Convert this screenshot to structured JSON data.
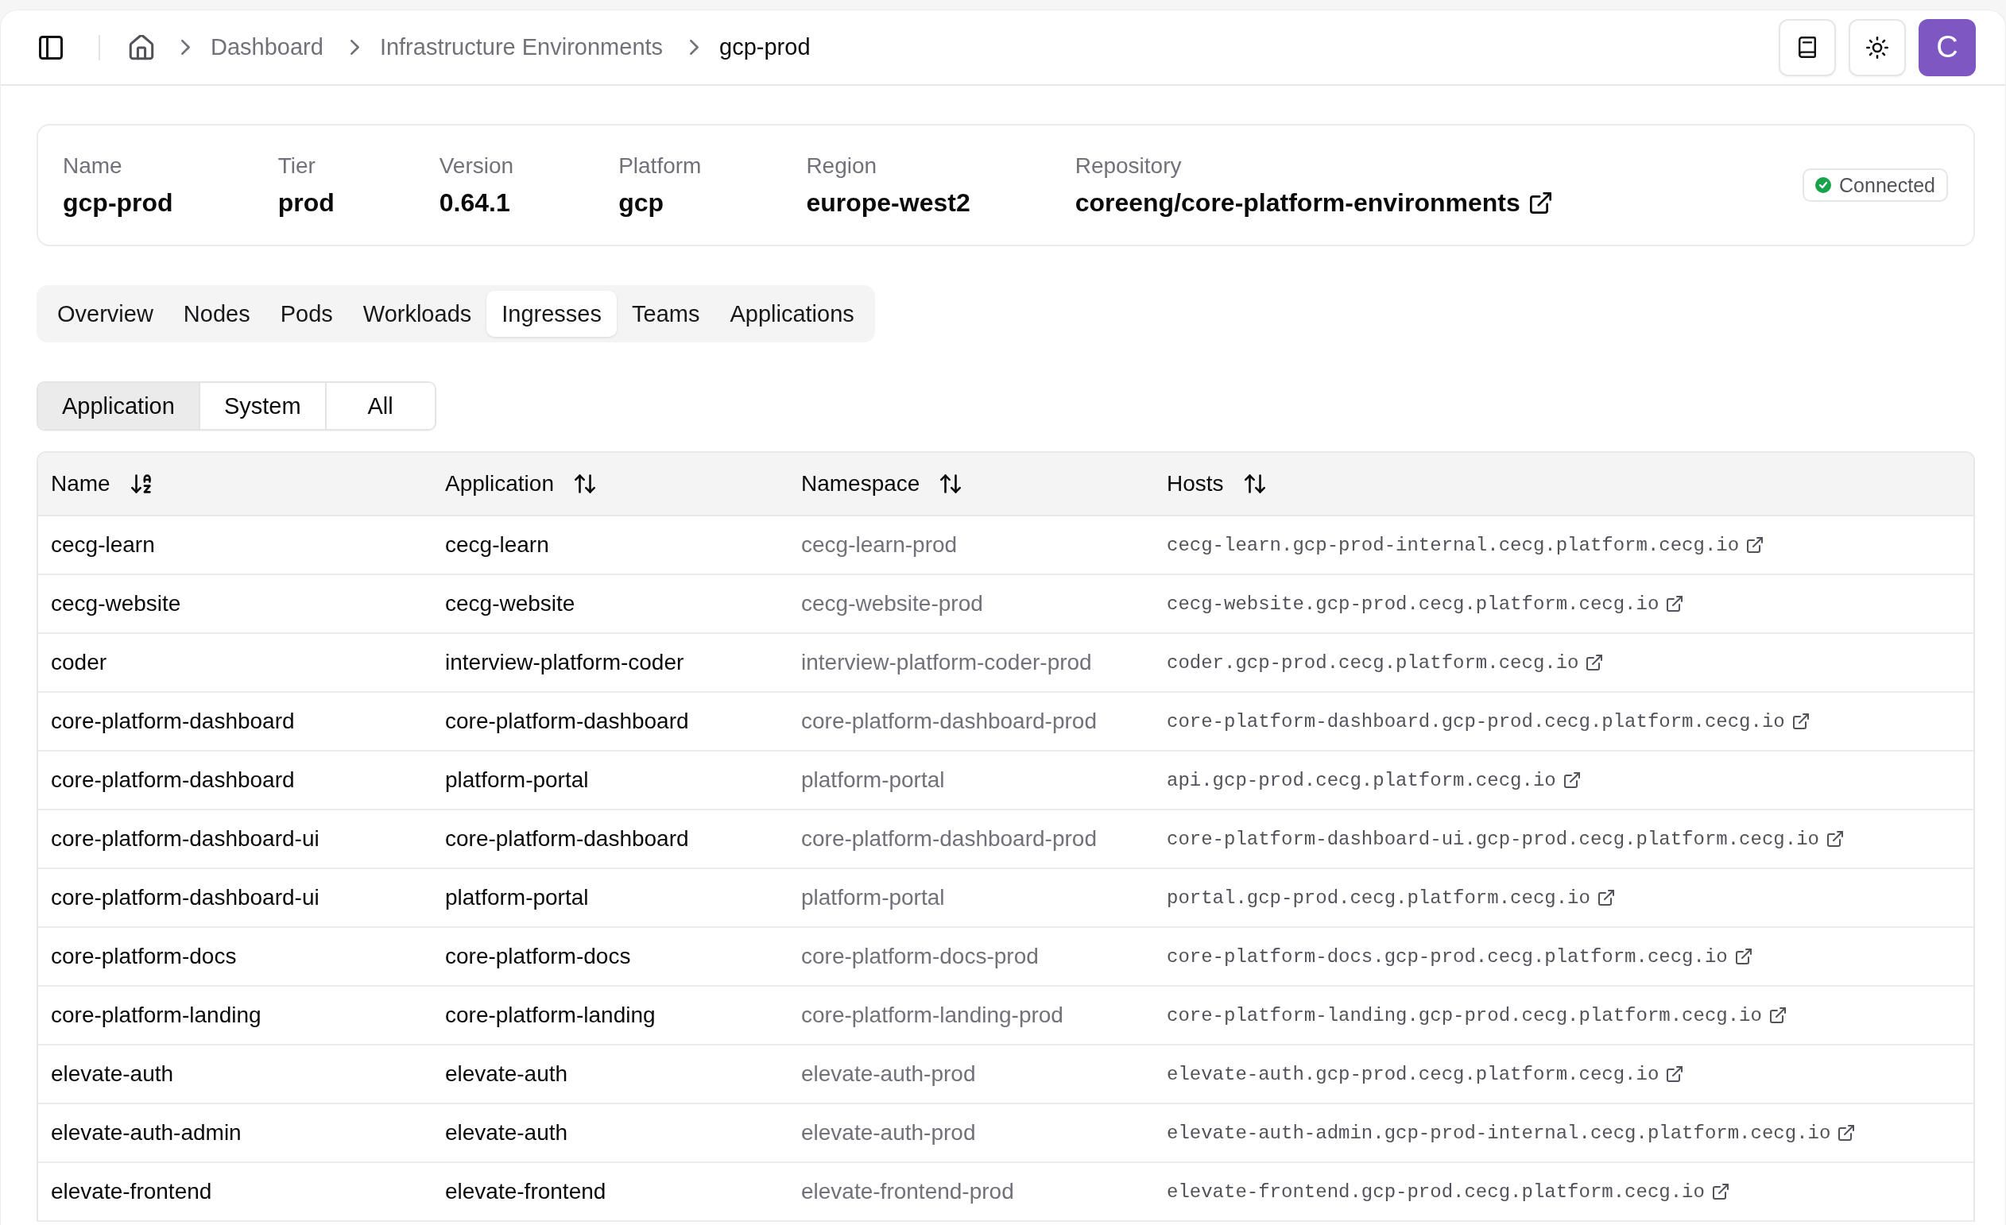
{
  "header": {
    "breadcrumbs": [
      {
        "label": "Dashboard",
        "current": false
      },
      {
        "label": "Infrastructure Environments",
        "current": false
      },
      {
        "label": "gcp-prod",
        "current": true
      }
    ],
    "avatar": {
      "initial": "C"
    }
  },
  "environment": {
    "fields": [
      {
        "label": "Name",
        "value": "gcp-prod",
        "kind": "text"
      },
      {
        "label": "Tier",
        "value": "prod",
        "kind": "text"
      },
      {
        "label": "Version",
        "value": "0.64.1",
        "kind": "text"
      },
      {
        "label": "Platform",
        "value": "gcp",
        "kind": "text"
      },
      {
        "label": "Region",
        "value": "europe-west2",
        "kind": "text"
      },
      {
        "label": "Repository",
        "value": "coreeng/core-platform-environments",
        "kind": "link"
      }
    ],
    "status": {
      "label": "Connected",
      "connected": true
    }
  },
  "tabs": [
    {
      "label": "Overview",
      "selected": false
    },
    {
      "label": "Nodes",
      "selected": false
    },
    {
      "label": "Pods",
      "selected": false
    },
    {
      "label": "Workloads",
      "selected": false
    },
    {
      "label": "Ingresses",
      "selected": true
    },
    {
      "label": "Teams",
      "selected": false
    },
    {
      "label": "Applications",
      "selected": false
    }
  ],
  "filters": [
    {
      "label": "Application",
      "selected": true
    },
    {
      "label": "System",
      "selected": false
    },
    {
      "label": "All",
      "selected": false
    }
  ],
  "table": {
    "columns": [
      {
        "label": "Name",
        "sorted": true
      },
      {
        "label": "Application",
        "sorted": false
      },
      {
        "label": "Namespace",
        "sorted": false
      },
      {
        "label": "Hosts",
        "sorted": false
      }
    ],
    "rows": [
      {
        "name": "cecg-learn",
        "application": "cecg-learn",
        "namespace": "cecg-learn-prod",
        "host": "cecg-learn.gcp-prod-internal.cecg.platform.cecg.io"
      },
      {
        "name": "cecg-website",
        "application": "cecg-website",
        "namespace": "cecg-website-prod",
        "host": "cecg-website.gcp-prod.cecg.platform.cecg.io"
      },
      {
        "name": "coder",
        "application": "interview-platform-coder",
        "namespace": "interview-platform-coder-prod",
        "host": "coder.gcp-prod.cecg.platform.cecg.io"
      },
      {
        "name": "core-platform-dashboard",
        "application": "core-platform-dashboard",
        "namespace": "core-platform-dashboard-prod",
        "host": "core-platform-dashboard.gcp-prod.cecg.platform.cecg.io"
      },
      {
        "name": "core-platform-dashboard",
        "application": "platform-portal",
        "namespace": "platform-portal",
        "host": "api.gcp-prod.cecg.platform.cecg.io"
      },
      {
        "name": "core-platform-dashboard-ui",
        "application": "core-platform-dashboard",
        "namespace": "core-platform-dashboard-prod",
        "host": "core-platform-dashboard-ui.gcp-prod.cecg.platform.cecg.io"
      },
      {
        "name": "core-platform-dashboard-ui",
        "application": "platform-portal",
        "namespace": "platform-portal",
        "host": "portal.gcp-prod.cecg.platform.cecg.io"
      },
      {
        "name": "core-platform-docs",
        "application": "core-platform-docs",
        "namespace": "core-platform-docs-prod",
        "host": "core-platform-docs.gcp-prod.cecg.platform.cecg.io"
      },
      {
        "name": "core-platform-landing",
        "application": "core-platform-landing",
        "namespace": "core-platform-landing-prod",
        "host": "core-platform-landing.gcp-prod.cecg.platform.cecg.io"
      },
      {
        "name": "elevate-auth",
        "application": "elevate-auth",
        "namespace": "elevate-auth-prod",
        "host": "elevate-auth.gcp-prod.cecg.platform.cecg.io"
      },
      {
        "name": "elevate-auth-admin",
        "application": "elevate-auth",
        "namespace": "elevate-auth-prod",
        "host": "elevate-auth-admin.gcp-prod-internal.cecg.platform.cecg.io"
      },
      {
        "name": "elevate-frontend",
        "application": "elevate-frontend",
        "namespace": "elevate-frontend-prod",
        "host": "elevate-frontend.gcp-prod.cecg.platform.cecg.io"
      }
    ]
  }
}
